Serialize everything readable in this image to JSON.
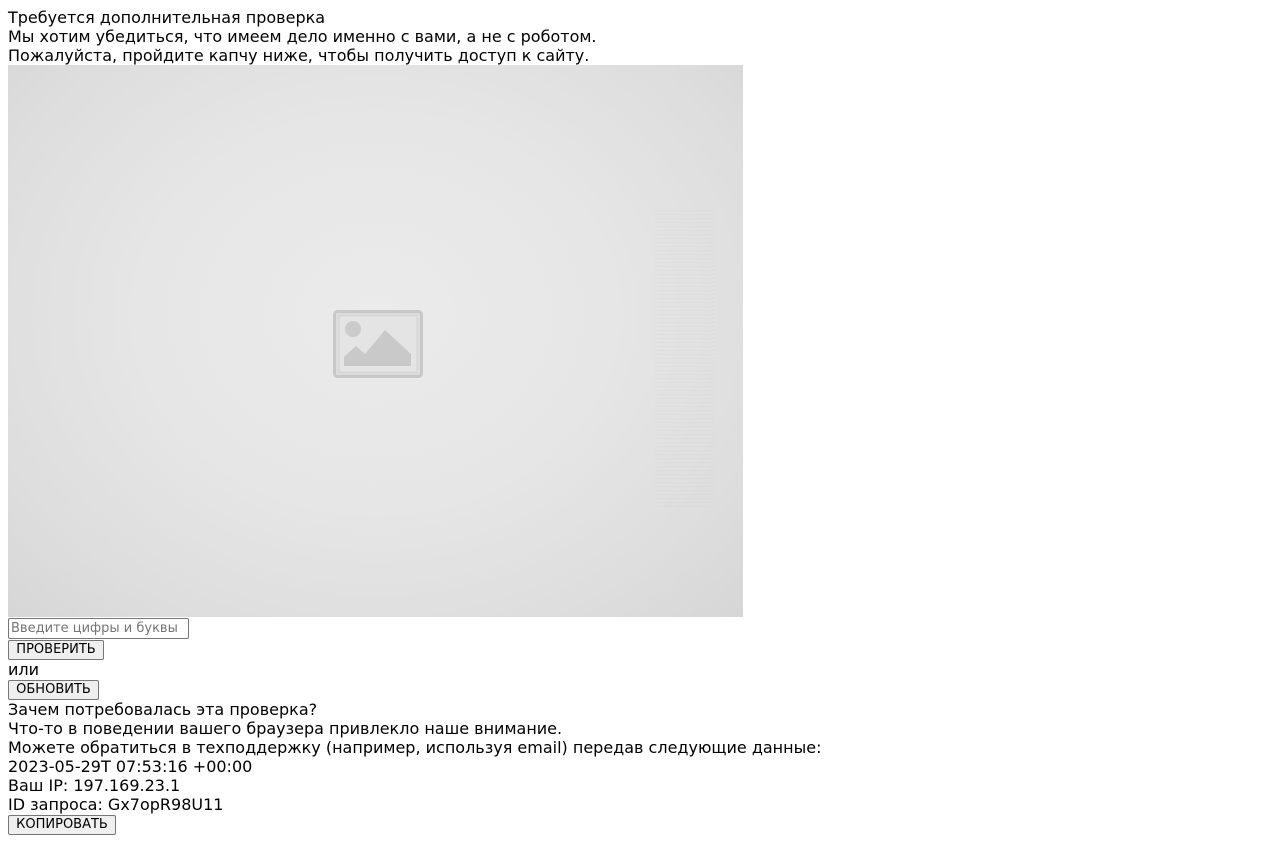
{
  "header": {
    "title": "Требуется дополнительная проверка",
    "line1": "Мы хотим убедиться, что имеем дело именно с вами, а не с роботом.",
    "line2": "Пожалуйста, пройдите капчу ниже, чтобы получить доступ к сайту."
  },
  "captcha": {
    "image_icon": "image-placeholder-icon",
    "input_placeholder": "Введите цифры и буквы",
    "input_value": "",
    "verify_label": "ПРОВЕРИТЬ",
    "or_text": "или",
    "refresh_label": "ОБНОВИТЬ"
  },
  "info": {
    "why_title": "Зачем потребовалась эта проверка?",
    "why_text": "Что-то в поведении вашего браузера привлекло наше внимание.",
    "support_text": "Можете обратиться в техподдержку (например, используя email) передав следующие данные:",
    "timestamp": "2023-05-29T 07:53:16 +00:00",
    "ip_line": "Ваш IP: 197.169.23.1",
    "request_id_line": "ID запроса: Gx7opR98U11",
    "copy_label": "КОПИРОВАТЬ"
  },
  "colors": {
    "background": "#ffffff",
    "text": "#000000",
    "button_bg": "#efefef",
    "border": "#767676",
    "captcha_bg": "#e6e6e6"
  }
}
